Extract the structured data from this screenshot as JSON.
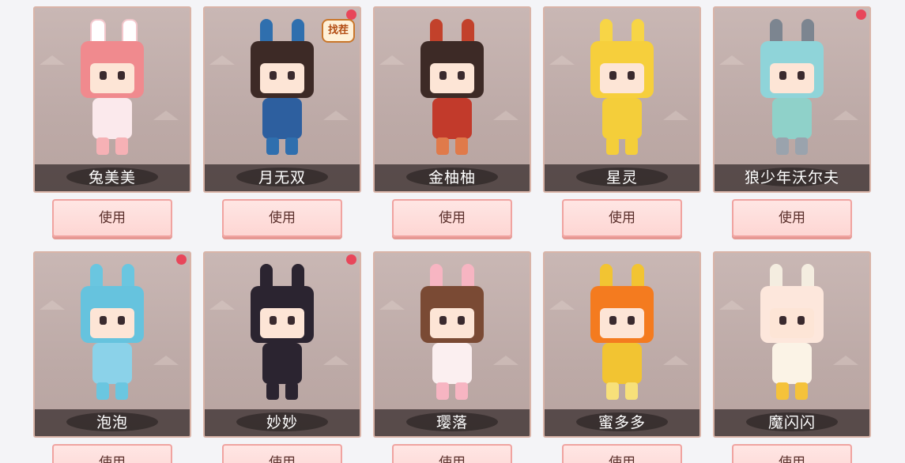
{
  "items": [
    {
      "name": "兔美美",
      "use_label": "使用",
      "has_dot": false,
      "badge": "",
      "hair": "#f08a8e",
      "hat": "#ffffff",
      "outfit": "#fbe9ec",
      "accent": "#f6b1b5"
    },
    {
      "name": "月无双",
      "use_label": "使用",
      "has_dot": true,
      "badge": "找茬",
      "hair": "#3d2a26",
      "hat": "#2f6fae",
      "outfit": "#2d5f9f",
      "accent": "#2f6fae"
    },
    {
      "name": "金柚柚",
      "use_label": "使用",
      "has_dot": false,
      "badge": "",
      "hair": "#3d2a26",
      "hat": "#c2412b",
      "outfit": "#c23a2b",
      "accent": "#e07a4a"
    },
    {
      "name": "星灵",
      "use_label": "使用",
      "has_dot": false,
      "badge": "",
      "hair": "#f6cf3c",
      "hat": "#f7d546",
      "outfit": "#f4ce3a",
      "accent": "#f4ce3a"
    },
    {
      "name": "狼少年沃尔夫",
      "use_label": "使用",
      "has_dot": true,
      "badge": "",
      "hair": "#8fd4d9",
      "hat": "#7c8590",
      "outfit": "#8fd1c9",
      "accent": "#9aa3ad"
    },
    {
      "name": "泡泡",
      "use_label": "使用",
      "has_dot": true,
      "badge": "",
      "hair": "#66c3de",
      "hat": "#6ac6e0",
      "outfit": "#8bd2e9",
      "accent": "#6ac6e0"
    },
    {
      "name": "妙妙",
      "use_label": "使用",
      "has_dot": true,
      "badge": "",
      "hair": "#2b2430",
      "hat": "#2b2430",
      "outfit": "#2b2430",
      "accent": "#2b2430"
    },
    {
      "name": "璎落",
      "use_label": "使用",
      "has_dot": false,
      "badge": "",
      "hair": "#7a4a34",
      "hat": "#f7b5c2",
      "outfit": "#fbeff0",
      "accent": "#f7b5c2"
    },
    {
      "name": "蜜多多",
      "use_label": "使用",
      "has_dot": false,
      "badge": "",
      "hair": "#f47b1f",
      "hat": "#f2c432",
      "outfit": "#f2c432",
      "accent": "#f7e07a"
    },
    {
      "name": "魔闪闪",
      "use_label": "使用",
      "has_dot": false,
      "badge": "",
      "hair": "#fde7dc",
      "hat": "#f4ede0",
      "outfit": "#fbf3e6",
      "accent": "#f5c23a"
    }
  ],
  "colors": {
    "card_border": "#d9b4a8",
    "dot": "#e8465a",
    "button_fill": "#fdd6d3",
    "button_text": "#5a2f2b"
  }
}
